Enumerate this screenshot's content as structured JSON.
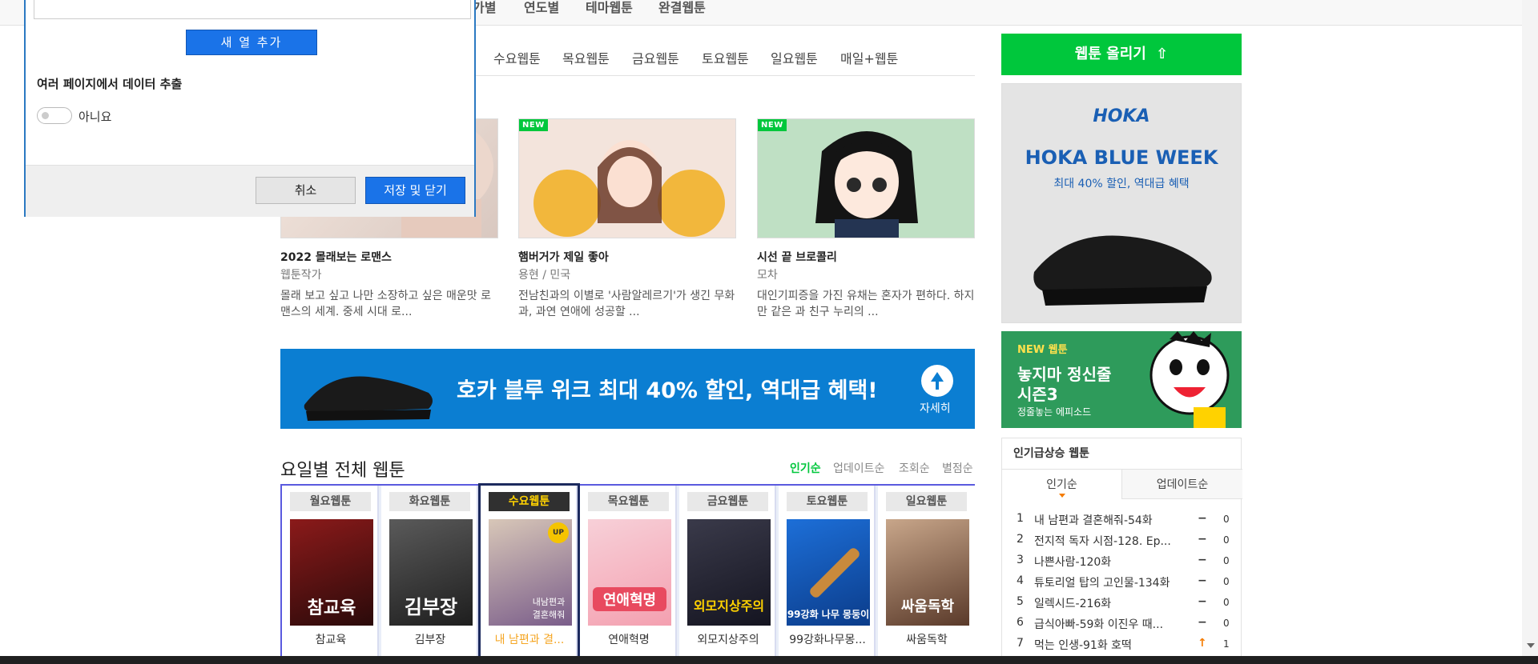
{
  "topnav": {
    "items": [
      "가별",
      "연도별",
      "테마웹툰",
      "완결웹툰"
    ]
  },
  "daytabs": [
    "수요웹툰",
    "목요웹툰",
    "금요웹툰",
    "토요웹툰",
    "일요웹툰",
    "매일+웹툰"
  ],
  "cards": [
    {
      "title": "2022 몰래보는 로맨스",
      "author": "웹툰작가",
      "desc": "몰래 보고 싶고 나만 소장하고 싶은 매운맛 로맨스의 세계. 중세 시대 로...",
      "new": false
    },
    {
      "title": "햄버거가 제일 좋아",
      "author": "용현 / 민국",
      "desc": "전남친과의 이별로 '사람알레르기'가 생긴 무화과, 과연 연애에 성공할 ...",
      "new": true
    },
    {
      "title": "시선 끝 브로콜리",
      "author": "모차",
      "desc": "대인기피증을 가진 유채는 혼자가 편하다. 하지만 같은 과 친구 누리의 ...",
      "new": true
    }
  ],
  "badge_new": "NEW",
  "banner": {
    "text": "호카 블루 위크 최대 40% 할인, 역대급 혜택!",
    "more": "자세히"
  },
  "section": {
    "title": "요일별 전체 웹툰",
    "sorts": [
      "인기순",
      "업데이트순",
      "조회순",
      "별점순"
    ]
  },
  "days": [
    {
      "label": "월요웹툰",
      "name": "참교육",
      "poster_text": "참교육",
      "colors": [
        "#8b1a1a",
        "#2a0a0a"
      ]
    },
    {
      "label": "화요웹툰",
      "name": "김부장",
      "poster_text": "김부장",
      "colors": [
        "#5a5a5a",
        "#1e1e1e"
      ]
    },
    {
      "label": "수요웹툰",
      "name": "내 남편과 결...",
      "poster_text": "내남편과 결혼해줘",
      "colors": [
        "#d8c7b8",
        "#7a5d8a"
      ],
      "badge": "UP"
    },
    {
      "label": "목요웹툰",
      "name": "연애혁명",
      "poster_text": "연애혁명",
      "colors": [
        "#f7d0d8",
        "#f4a0b0"
      ]
    },
    {
      "label": "금요웹툰",
      "name": "외모지상주의",
      "poster_text": "외모지상주의",
      "colors": [
        "#3a3a4a",
        "#141420"
      ]
    },
    {
      "label": "토요웹툰",
      "name": "99강화나무몽...",
      "poster_text": "99강화 나무 몽둥이",
      "colors": [
        "#1d6fd8",
        "#0b3c8a"
      ]
    },
    {
      "label": "일요웹툰",
      "name": "싸움독학",
      "poster_text": "싸움독학",
      "colors": [
        "#c8a68a",
        "#5a3a2a"
      ]
    }
  ],
  "sidebar": {
    "upload": "웹툰 올리기",
    "ad1": {
      "brand": "HOKA",
      "headline": "HOKA BLUE WEEK",
      "sub": "최대 40% 할인, 역대급 혜택"
    },
    "ad2": {
      "tag": "NEW 웹툰",
      "title1": "놓지마 정신줄",
      "title2": "시즌3",
      "sub": "정줄놓는 에피소드"
    },
    "rank": {
      "title": "인기급상승 웹툰",
      "tabs": [
        "인기순",
        "업데이트순"
      ],
      "items": [
        {
          "n": "1",
          "t": "내 남편과 결혼해줘-54화",
          "m": "−",
          "v": "0",
          "up": false
        },
        {
          "n": "2",
          "t": "전지적 독자 시점-128. Ep...",
          "m": "−",
          "v": "0",
          "up": false
        },
        {
          "n": "3",
          "t": "나쁜사람-120화",
          "m": "−",
          "v": "0",
          "up": false
        },
        {
          "n": "4",
          "t": "튜토리얼 탑의 고인물-134화",
          "m": "−",
          "v": "0",
          "up": false
        },
        {
          "n": "5",
          "t": "일렉시드-216화",
          "m": "−",
          "v": "0",
          "up": false
        },
        {
          "n": "6",
          "t": "급식아빠-59화 이진우 때...",
          "m": "−",
          "v": "0",
          "up": false
        },
        {
          "n": "7",
          "t": "먹는 인생-91화 호떡",
          "m": "↑",
          "v": "1",
          "up": true
        }
      ]
    }
  },
  "dialog": {
    "add_column": "새 열 추가",
    "multi_page_label": "여러 페이지에서 데이터 추출",
    "toggle_label": "아니요",
    "cancel": "취소",
    "save_close": "저장 및 닫기"
  }
}
